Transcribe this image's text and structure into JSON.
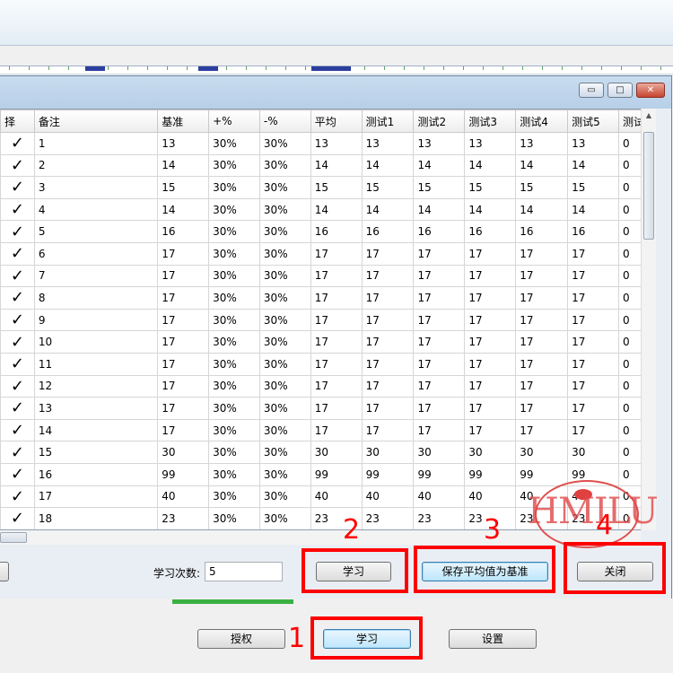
{
  "grid": {
    "columns": [
      "择",
      "备注",
      "基准",
      "+%",
      "-%",
      "平均",
      "测试1",
      "测试2",
      "测试3",
      "测试4",
      "测试5",
      "测试"
    ],
    "rows": [
      [
        "1",
        "13",
        "30%",
        "30%",
        "13",
        "13",
        "13",
        "13",
        "13",
        "13",
        "0"
      ],
      [
        "2",
        "14",
        "30%",
        "30%",
        "14",
        "14",
        "14",
        "14",
        "14",
        "14",
        "0"
      ],
      [
        "3",
        "15",
        "30%",
        "30%",
        "15",
        "15",
        "15",
        "15",
        "15",
        "15",
        "0"
      ],
      [
        "4",
        "14",
        "30%",
        "30%",
        "14",
        "14",
        "14",
        "14",
        "14",
        "14",
        "0"
      ],
      [
        "5",
        "16",
        "30%",
        "30%",
        "16",
        "16",
        "16",
        "16",
        "16",
        "16",
        "0"
      ],
      [
        "6",
        "17",
        "30%",
        "30%",
        "17",
        "17",
        "17",
        "17",
        "17",
        "17",
        "0"
      ],
      [
        "7",
        "17",
        "30%",
        "30%",
        "17",
        "17",
        "17",
        "17",
        "17",
        "17",
        "0"
      ],
      [
        "8",
        "17",
        "30%",
        "30%",
        "17",
        "17",
        "17",
        "17",
        "17",
        "17",
        "0"
      ],
      [
        "9",
        "17",
        "30%",
        "30%",
        "17",
        "17",
        "17",
        "17",
        "17",
        "17",
        "0"
      ],
      [
        "10",
        "17",
        "30%",
        "30%",
        "17",
        "17",
        "17",
        "17",
        "17",
        "17",
        "0"
      ],
      [
        "11",
        "17",
        "30%",
        "30%",
        "17",
        "17",
        "17",
        "17",
        "17",
        "17",
        "0"
      ],
      [
        "12",
        "17",
        "30%",
        "30%",
        "17",
        "17",
        "17",
        "17",
        "17",
        "17",
        "0"
      ],
      [
        "13",
        "17",
        "30%",
        "30%",
        "17",
        "17",
        "17",
        "17",
        "17",
        "17",
        "0"
      ],
      [
        "14",
        "17",
        "30%",
        "30%",
        "17",
        "17",
        "17",
        "17",
        "17",
        "17",
        "0"
      ],
      [
        "15",
        "30",
        "30%",
        "30%",
        "30",
        "30",
        "30",
        "30",
        "30",
        "30",
        "0"
      ],
      [
        "16",
        "99",
        "30%",
        "30%",
        "99",
        "99",
        "99",
        "99",
        "99",
        "99",
        "0"
      ],
      [
        "17",
        "40",
        "30%",
        "30%",
        "40",
        "40",
        "40",
        "40",
        "40",
        "40",
        "0"
      ],
      [
        "18",
        "23",
        "30%",
        "30%",
        "23",
        "23",
        "23",
        "23",
        "23",
        "23",
        "0"
      ]
    ],
    "check_glyph": "✓"
  },
  "window_controls": {
    "minimize": "▭",
    "maximize": "□",
    "close": "✕"
  },
  "dialog_bottom": {
    "learn_count_label": "学习次数:",
    "learn_count_value": "5",
    "learn_button": "学习",
    "save_avg_button": "保存平均值为基准",
    "close_button": "关闭"
  },
  "main_bottom": {
    "auth_button": "授权",
    "learn_button": "学习",
    "settings_button": "设置"
  },
  "annotations": {
    "n1": "1",
    "n2": "2",
    "n3": "3",
    "n4": "4",
    "color": "#ff0000"
  },
  "watermark": {
    "text": "HMILU"
  }
}
